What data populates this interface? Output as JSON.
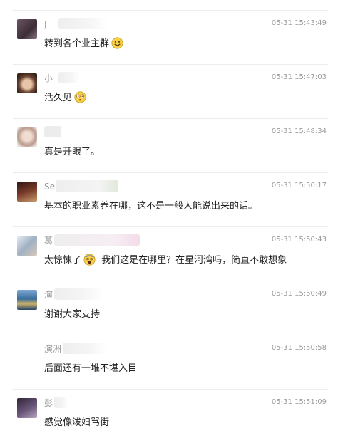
{
  "comments": [
    {
      "name": "J",
      "time": "05-31 15:43:49",
      "text": "转到各个业主群",
      "emoji": "smile",
      "avatar": "#4a3a44"
    },
    {
      "name": "小",
      "time": "05-31 15:47:03",
      "text": "活久见",
      "emoji": "dizzy",
      "avatar": "#7d5a45"
    },
    {
      "name": "",
      "time": "05-31 15:48:34",
      "text": "真是开眼了。",
      "emoji": "",
      "avatar": "#d9c7c0"
    },
    {
      "name": "Se",
      "time": "05-31 15:50:17",
      "text": "基本的职业素养在哪，这不是一般人能说出来的话。",
      "emoji": "",
      "avatar": "#5a3328"
    },
    {
      "name": "葛",
      "time": "05-31 15:50:43",
      "text": "太惊悚了",
      "emoji": "scared",
      "text2": "我们这是在哪里？在星河湾吗，简直不敢想象",
      "avatar": "#c9cfd6"
    },
    {
      "name": "演",
      "time": "05-31 15:50:49",
      "text": "谢谢大家支持",
      "emoji": "",
      "avatar": "#3a6f9a"
    },
    {
      "name": "演洲",
      "time": "05-31 15:50:58",
      "text": "后面还有一堆不堪入目",
      "emoji": "",
      "avatar": ""
    },
    {
      "name": "彭",
      "time": "05-31 15:51:09",
      "text": "感觉像泼妇骂街",
      "emoji": "",
      "avatar": "#4b3b52"
    }
  ]
}
